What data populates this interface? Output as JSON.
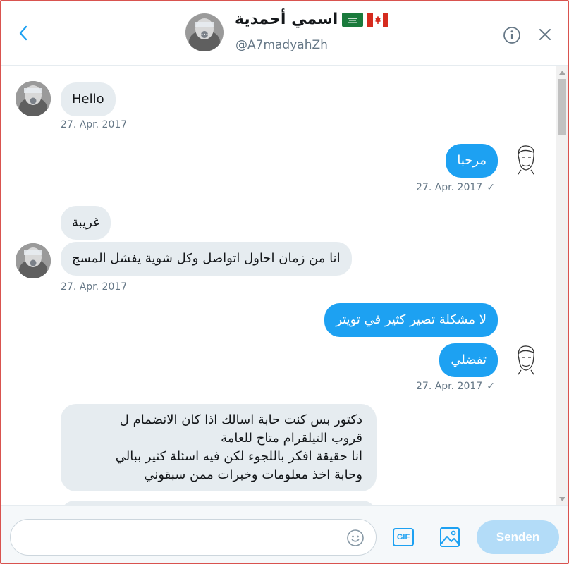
{
  "header": {
    "title": "اسمي أحمدية",
    "handle": "@A7madyahZh",
    "back_icon": "chevron-left-icon",
    "info_icon": "info-icon",
    "close_icon": "close-icon"
  },
  "messages": [
    {
      "direction": "in",
      "text": "Hello",
      "timestamp": "27. Apr. 2017"
    },
    {
      "direction": "out",
      "text": "مرحبا",
      "timestamp": "27. Apr. 2017",
      "status": "✓"
    },
    {
      "direction": "in",
      "text": "غريبة"
    },
    {
      "direction": "in",
      "text": "انا من زمان احاول اتواصل وكل شوية يفشل المسج",
      "timestamp": "27. Apr. 2017"
    },
    {
      "direction": "out",
      "text": "لا مشكلة تصير كثير في تويتر"
    },
    {
      "direction": "out",
      "text": "تفضلي",
      "timestamp": "27. Apr. 2017",
      "status": "✓"
    },
    {
      "direction": "in",
      "lines": [
        "دكتور بس كنت حابة اسالك اذا كان الانضمام ل",
        "قروب التيلقرام متاح للعامة",
        "انا حقيقة افكر باللجوء لكن فيه اسئلة كثير ببالي",
        "وحابة اخذ معلومات وخبرات ممن سبقوني"
      ]
    }
  ],
  "composer": {
    "placeholder": "",
    "gif_label": "GIF",
    "send_label": "Senden"
  },
  "colors": {
    "accent": "#1da1f2",
    "incoming_bubble": "#e6ecf0",
    "send_disabled": "#b3dcf8"
  }
}
